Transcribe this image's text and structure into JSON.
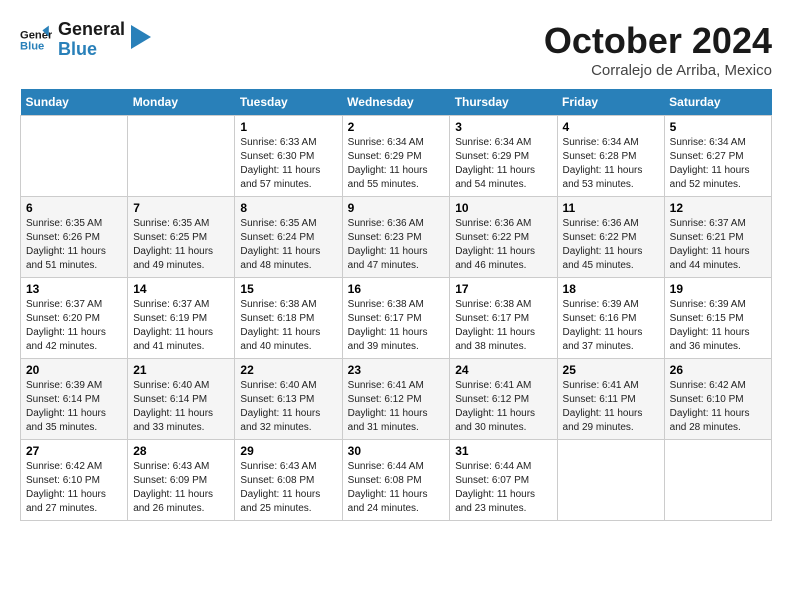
{
  "header": {
    "logo_line1": "General",
    "logo_line2": "Blue",
    "month": "October 2024",
    "location": "Corralejo de Arriba, Mexico"
  },
  "weekdays": [
    "Sunday",
    "Monday",
    "Tuesday",
    "Wednesday",
    "Thursday",
    "Friday",
    "Saturday"
  ],
  "weeks": [
    [
      {
        "day": "",
        "info": ""
      },
      {
        "day": "",
        "info": ""
      },
      {
        "day": "1",
        "info": "Sunrise: 6:33 AM\nSunset: 6:30 PM\nDaylight: 11 hours and 57 minutes."
      },
      {
        "day": "2",
        "info": "Sunrise: 6:34 AM\nSunset: 6:29 PM\nDaylight: 11 hours and 55 minutes."
      },
      {
        "day": "3",
        "info": "Sunrise: 6:34 AM\nSunset: 6:29 PM\nDaylight: 11 hours and 54 minutes."
      },
      {
        "day": "4",
        "info": "Sunrise: 6:34 AM\nSunset: 6:28 PM\nDaylight: 11 hours and 53 minutes."
      },
      {
        "day": "5",
        "info": "Sunrise: 6:34 AM\nSunset: 6:27 PM\nDaylight: 11 hours and 52 minutes."
      }
    ],
    [
      {
        "day": "6",
        "info": "Sunrise: 6:35 AM\nSunset: 6:26 PM\nDaylight: 11 hours and 51 minutes."
      },
      {
        "day": "7",
        "info": "Sunrise: 6:35 AM\nSunset: 6:25 PM\nDaylight: 11 hours and 49 minutes."
      },
      {
        "day": "8",
        "info": "Sunrise: 6:35 AM\nSunset: 6:24 PM\nDaylight: 11 hours and 48 minutes."
      },
      {
        "day": "9",
        "info": "Sunrise: 6:36 AM\nSunset: 6:23 PM\nDaylight: 11 hours and 47 minutes."
      },
      {
        "day": "10",
        "info": "Sunrise: 6:36 AM\nSunset: 6:22 PM\nDaylight: 11 hours and 46 minutes."
      },
      {
        "day": "11",
        "info": "Sunrise: 6:36 AM\nSunset: 6:22 PM\nDaylight: 11 hours and 45 minutes."
      },
      {
        "day": "12",
        "info": "Sunrise: 6:37 AM\nSunset: 6:21 PM\nDaylight: 11 hours and 44 minutes."
      }
    ],
    [
      {
        "day": "13",
        "info": "Sunrise: 6:37 AM\nSunset: 6:20 PM\nDaylight: 11 hours and 42 minutes."
      },
      {
        "day": "14",
        "info": "Sunrise: 6:37 AM\nSunset: 6:19 PM\nDaylight: 11 hours and 41 minutes."
      },
      {
        "day": "15",
        "info": "Sunrise: 6:38 AM\nSunset: 6:18 PM\nDaylight: 11 hours and 40 minutes."
      },
      {
        "day": "16",
        "info": "Sunrise: 6:38 AM\nSunset: 6:17 PM\nDaylight: 11 hours and 39 minutes."
      },
      {
        "day": "17",
        "info": "Sunrise: 6:38 AM\nSunset: 6:17 PM\nDaylight: 11 hours and 38 minutes."
      },
      {
        "day": "18",
        "info": "Sunrise: 6:39 AM\nSunset: 6:16 PM\nDaylight: 11 hours and 37 minutes."
      },
      {
        "day": "19",
        "info": "Sunrise: 6:39 AM\nSunset: 6:15 PM\nDaylight: 11 hours and 36 minutes."
      }
    ],
    [
      {
        "day": "20",
        "info": "Sunrise: 6:39 AM\nSunset: 6:14 PM\nDaylight: 11 hours and 35 minutes."
      },
      {
        "day": "21",
        "info": "Sunrise: 6:40 AM\nSunset: 6:14 PM\nDaylight: 11 hours and 33 minutes."
      },
      {
        "day": "22",
        "info": "Sunrise: 6:40 AM\nSunset: 6:13 PM\nDaylight: 11 hours and 32 minutes."
      },
      {
        "day": "23",
        "info": "Sunrise: 6:41 AM\nSunset: 6:12 PM\nDaylight: 11 hours and 31 minutes."
      },
      {
        "day": "24",
        "info": "Sunrise: 6:41 AM\nSunset: 6:12 PM\nDaylight: 11 hours and 30 minutes."
      },
      {
        "day": "25",
        "info": "Sunrise: 6:41 AM\nSunset: 6:11 PM\nDaylight: 11 hours and 29 minutes."
      },
      {
        "day": "26",
        "info": "Sunrise: 6:42 AM\nSunset: 6:10 PM\nDaylight: 11 hours and 28 minutes."
      }
    ],
    [
      {
        "day": "27",
        "info": "Sunrise: 6:42 AM\nSunset: 6:10 PM\nDaylight: 11 hours and 27 minutes."
      },
      {
        "day": "28",
        "info": "Sunrise: 6:43 AM\nSunset: 6:09 PM\nDaylight: 11 hours and 26 minutes."
      },
      {
        "day": "29",
        "info": "Sunrise: 6:43 AM\nSunset: 6:08 PM\nDaylight: 11 hours and 25 minutes."
      },
      {
        "day": "30",
        "info": "Sunrise: 6:44 AM\nSunset: 6:08 PM\nDaylight: 11 hours and 24 minutes."
      },
      {
        "day": "31",
        "info": "Sunrise: 6:44 AM\nSunset: 6:07 PM\nDaylight: 11 hours and 23 minutes."
      },
      {
        "day": "",
        "info": ""
      },
      {
        "day": "",
        "info": ""
      }
    ]
  ]
}
